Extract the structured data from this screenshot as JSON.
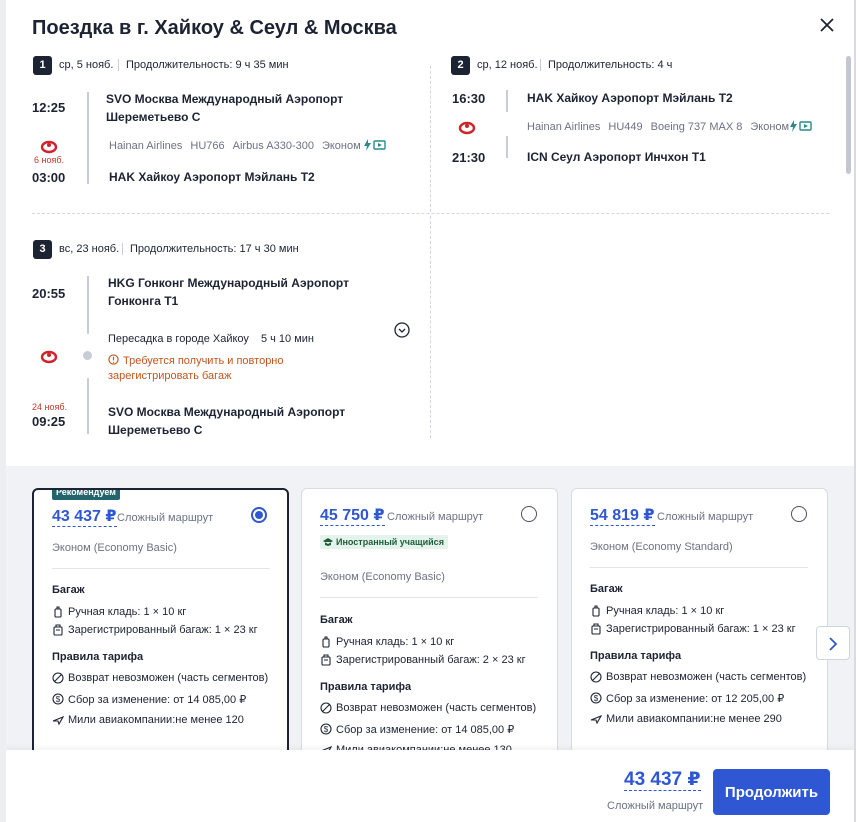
{
  "title": "Поездка в г. Хайкоу & Сеул & Москва",
  "colors": {
    "accent": "#2f57d3",
    "dark": "#1c2333",
    "recommended": "#24656d",
    "warning": "#c0561f",
    "next_day": "#c0392b"
  },
  "segments": [
    {
      "num": "1",
      "date": "ср, 5 нояб.",
      "duration": "Продолжительность: 9 ч 35 мин",
      "dep_time": "12:25",
      "dep_airport": "SVO Москва Международный Аэропорт Шереметьево C",
      "airline": "Hainan Airlines",
      "flight": "HU766",
      "aircraft": "Airbus A330-300",
      "cabin": "Эконом",
      "arr_note": "6 нояб.",
      "arr_time": "03:00",
      "arr_airport": "HAK Хайкоу Аэропорт Мэйлань T2"
    },
    {
      "num": "2",
      "date": "ср, 12 нояб.",
      "duration": "Продолжительность: 4 ч",
      "dep_time": "16:30",
      "dep_airport": "HAK Хайкоу Аэропорт Мэйлань T2",
      "airline": "Hainan Airlines",
      "flight": "HU449",
      "aircraft": "Boeing 737 MAX 8",
      "cabin": "Эконом",
      "arr_time": "21:30",
      "arr_airport": "ICN Сеул Аэропорт Инчхон T1"
    },
    {
      "num": "3",
      "date": "вс, 23 нояб.",
      "duration": "Продолжительность: 17 ч 30 мин",
      "dep_time": "20:55",
      "dep_airport": "HKG Гонконг Международный Аэропорт Гонконга T1",
      "transfer": "Пересадка в городе Хайкоу",
      "transfer_time": "5 ч 10 мин",
      "warning": "Требуется получить и повторно зарегистрировать багаж",
      "arr_note": "24 нояб.",
      "arr_time": "09:25",
      "arr_airport": "SVO Москва Международный Аэропорт Шереметьево C"
    }
  ],
  "fares": [
    {
      "recommended": "Рекомендуем",
      "price": "43 437 ₽",
      "type": "Сложный маршрут",
      "selected": true,
      "class": "Эконом (Economy Basic)",
      "baggage_title": "Багаж",
      "hand": "Ручная кладь: 1 × 10 кг",
      "checked": "Зарегистрированный багаж: 1 × 23 кг",
      "rules_title": "Правила тарифа",
      "refund": "Возврат невозможен (часть сегментов)",
      "change": "Сбор за изменение: от 14 085,00 ₽",
      "miles": "Мили авиакомпании:не менее 120"
    },
    {
      "price": "45 750 ₽",
      "type": "Сложный маршрут",
      "selected": false,
      "tag": "Иностранный учащийся",
      "class": "Эконом (Economy Basic)",
      "baggage_title": "Багаж",
      "hand": "Ручная кладь: 1 × 10 кг",
      "checked": "Зарегистрированный багаж: 2 × 23 кг",
      "rules_title": "Правила тарифа",
      "refund": "Возврат невозможен (часть сегментов)",
      "change": "Сбор за изменение: от 14 085,00 ₽",
      "miles": "Мили авиакомпании:не менее 130"
    },
    {
      "price": "54 819 ₽",
      "type": "Сложный маршрут",
      "selected": false,
      "class": "Эконом (Economy Standard)",
      "baggage_title": "Багаж",
      "hand": "Ручная кладь: 1 × 10 кг",
      "checked": "Зарегистрированный багаж: 1 × 23 кг",
      "rules_title": "Правила тарифа",
      "refund": "Возврат невозможен (часть сегментов)",
      "change": "Сбор за изменение: от 12 205,00 ₽",
      "miles": "Мили авиакомпании:не менее 290"
    }
  ],
  "footer": {
    "total": "43 437 ₽",
    "total_type": "Сложный маршрут",
    "continue": "Продолжить"
  }
}
